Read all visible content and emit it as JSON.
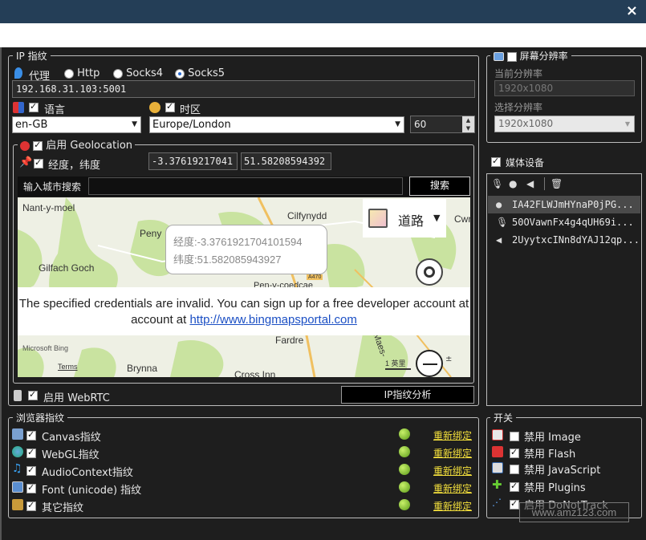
{
  "window": {
    "close_label": "×"
  },
  "ip": {
    "legend": "IP 指纹",
    "proxy_label": "代理",
    "options": [
      "Http",
      "Socks4",
      "Socks5"
    ],
    "selected": "Socks5",
    "address": "192.168.31.103:5001"
  },
  "lang": {
    "label": "语言",
    "value": "en-GB"
  },
  "tz": {
    "label": "时区",
    "value": "Europe/London",
    "offset": "60"
  },
  "geo": {
    "legend": "启用 Geolocation",
    "coord_label": "经度，纬度",
    "longitude": "-3.37619217041",
    "latitude": "51.58208594392",
    "search_label": "输入城市搜索",
    "search_value": "",
    "search_button": "搜索"
  },
  "map": {
    "places": [
      "Nant-y-moel",
      "Cilfynydd",
      "Cwmt",
      "Peny",
      "Gilfach Goch",
      "Fardre",
      "Brynna",
      "Cross Inn",
      "Maes-",
      "Pen-y-coedcae",
      "A470"
    ],
    "road_label": "道路",
    "popup_lng": "经度:-3.3761921704101594",
    "popup_lat": "纬度:51.582085943927",
    "notice": "The specified credentials are invalid. You can sign up for a free developer account at",
    "notice_link": "http://www.bingmapsportal.com",
    "brand": "Microsoft Bing",
    "terms": "Terms",
    "scale": "1 英里",
    "scale_tail": "±"
  },
  "webrtc": {
    "label": "启用 WebRTC",
    "analyze_button": "IP指纹分析"
  },
  "screen": {
    "legend": "屏幕分辨率",
    "current_label": "当前分辨率",
    "current_value": "1920x1080",
    "choose_label": "选择分辨率",
    "choose_value": "1920x1080"
  },
  "media": {
    "label": "媒体设备",
    "devices": [
      "IA42FLWJmHYnaP0jPG...",
      "50OVawnFx4g4qUH69i...",
      "2UyytxcINn8dYAJ12qp..."
    ]
  },
  "browser": {
    "legend": "浏览器指纹",
    "rebind": "重新绑定",
    "items": [
      "Canvas指纹",
      "WebGL指纹",
      "AudioContext指纹",
      "Font (unicode) 指纹",
      "其它指纹"
    ]
  },
  "switches": {
    "legend": "开关",
    "items": [
      {
        "label": "禁用 Image",
        "checked": false
      },
      {
        "label": "禁用 Flash",
        "checked": true
      },
      {
        "label": "禁用 JavaScript",
        "checked": false
      },
      {
        "label": "禁用 Plugins",
        "checked": true
      },
      {
        "label": "启用 DoNotTrack",
        "checked": true
      }
    ]
  },
  "watermark": "www.amz123.com",
  "colors": {
    "titlebar": "#243e57",
    "link": "#f5e13c",
    "background": "#1e1e1e"
  }
}
